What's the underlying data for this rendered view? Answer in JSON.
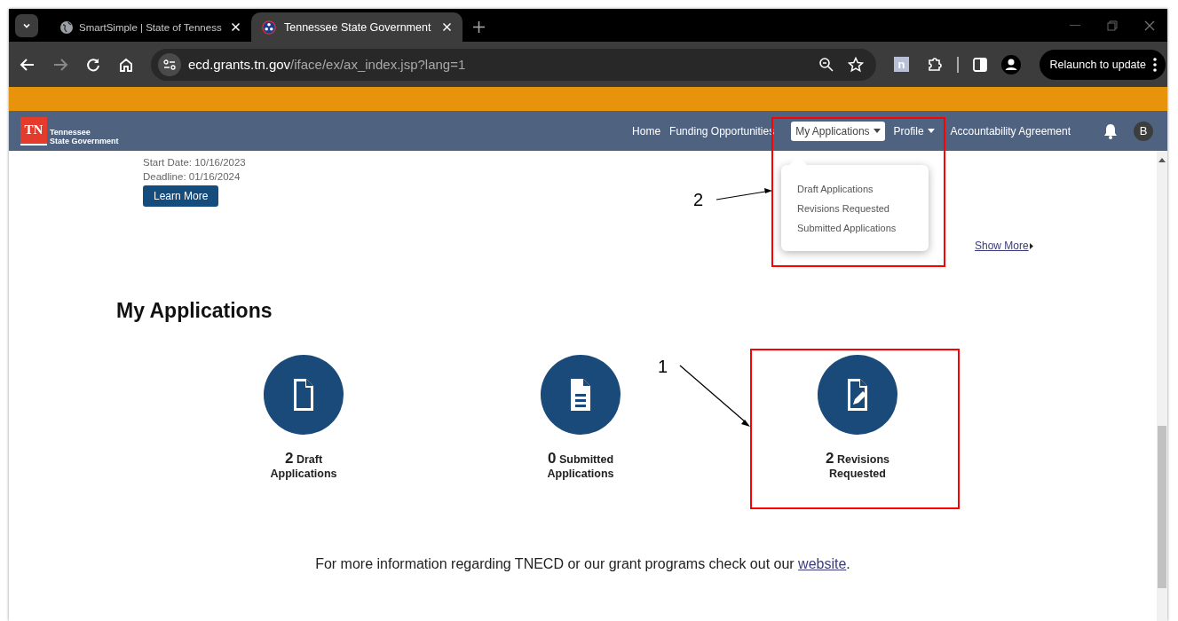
{
  "browser": {
    "tabs": [
      {
        "title": "SmartSimple | State of Tenness",
        "kind": "globe",
        "selected": false
      },
      {
        "title": "Tennessee State Government",
        "kind": "seal",
        "selected": true
      }
    ],
    "address": {
      "host": "ecd.grants.tn.gov",
      "path": "/iface/ex/ax_index.jsp?lang=1"
    },
    "extension_badge": "n",
    "relaunch_button": "Relaunch to update"
  },
  "site": {
    "logo": {
      "badge": "TN",
      "line_1": "Tennessee",
      "line_2": "State Government"
    },
    "nav": [
      {
        "label": "Home",
        "dropdown": false,
        "selected": false
      },
      {
        "label": "Funding Opportunities",
        "dropdown": false,
        "selected": false
      },
      {
        "label": "My Applications",
        "dropdown": true,
        "selected": true
      },
      {
        "label": "Profile",
        "dropdown": true,
        "selected": false
      },
      {
        "label": "Accountability Agreement",
        "dropdown": false,
        "selected": false
      }
    ],
    "avatar": "B",
    "dropdown_menu": [
      "Draft Applications",
      "Revisions Requested",
      "Submitted Applications"
    ]
  },
  "opportunity": {
    "start_date": "Start Date: 10/16/2023",
    "deadline": "Deadline: 01/16/2024",
    "button": "Learn More"
  },
  "show_more": "Show More",
  "section_title": "My Applications",
  "tiles": [
    {
      "kind": "blank",
      "count": "2",
      "word": "Draft",
      "line_2": "Applications"
    },
    {
      "kind": "lines",
      "count": "0",
      "word": "Submitted",
      "line_2": "Applications"
    },
    {
      "kind": "edit",
      "count": "2",
      "word": "Revisions",
      "line_2": "Requested"
    }
  ],
  "footer": {
    "text": "For more information regarding TNECD or our grant programs check out our ",
    "link": "website",
    "end": "."
  },
  "annotations": [
    {
      "number": "1"
    },
    {
      "number": "2"
    }
  ]
}
